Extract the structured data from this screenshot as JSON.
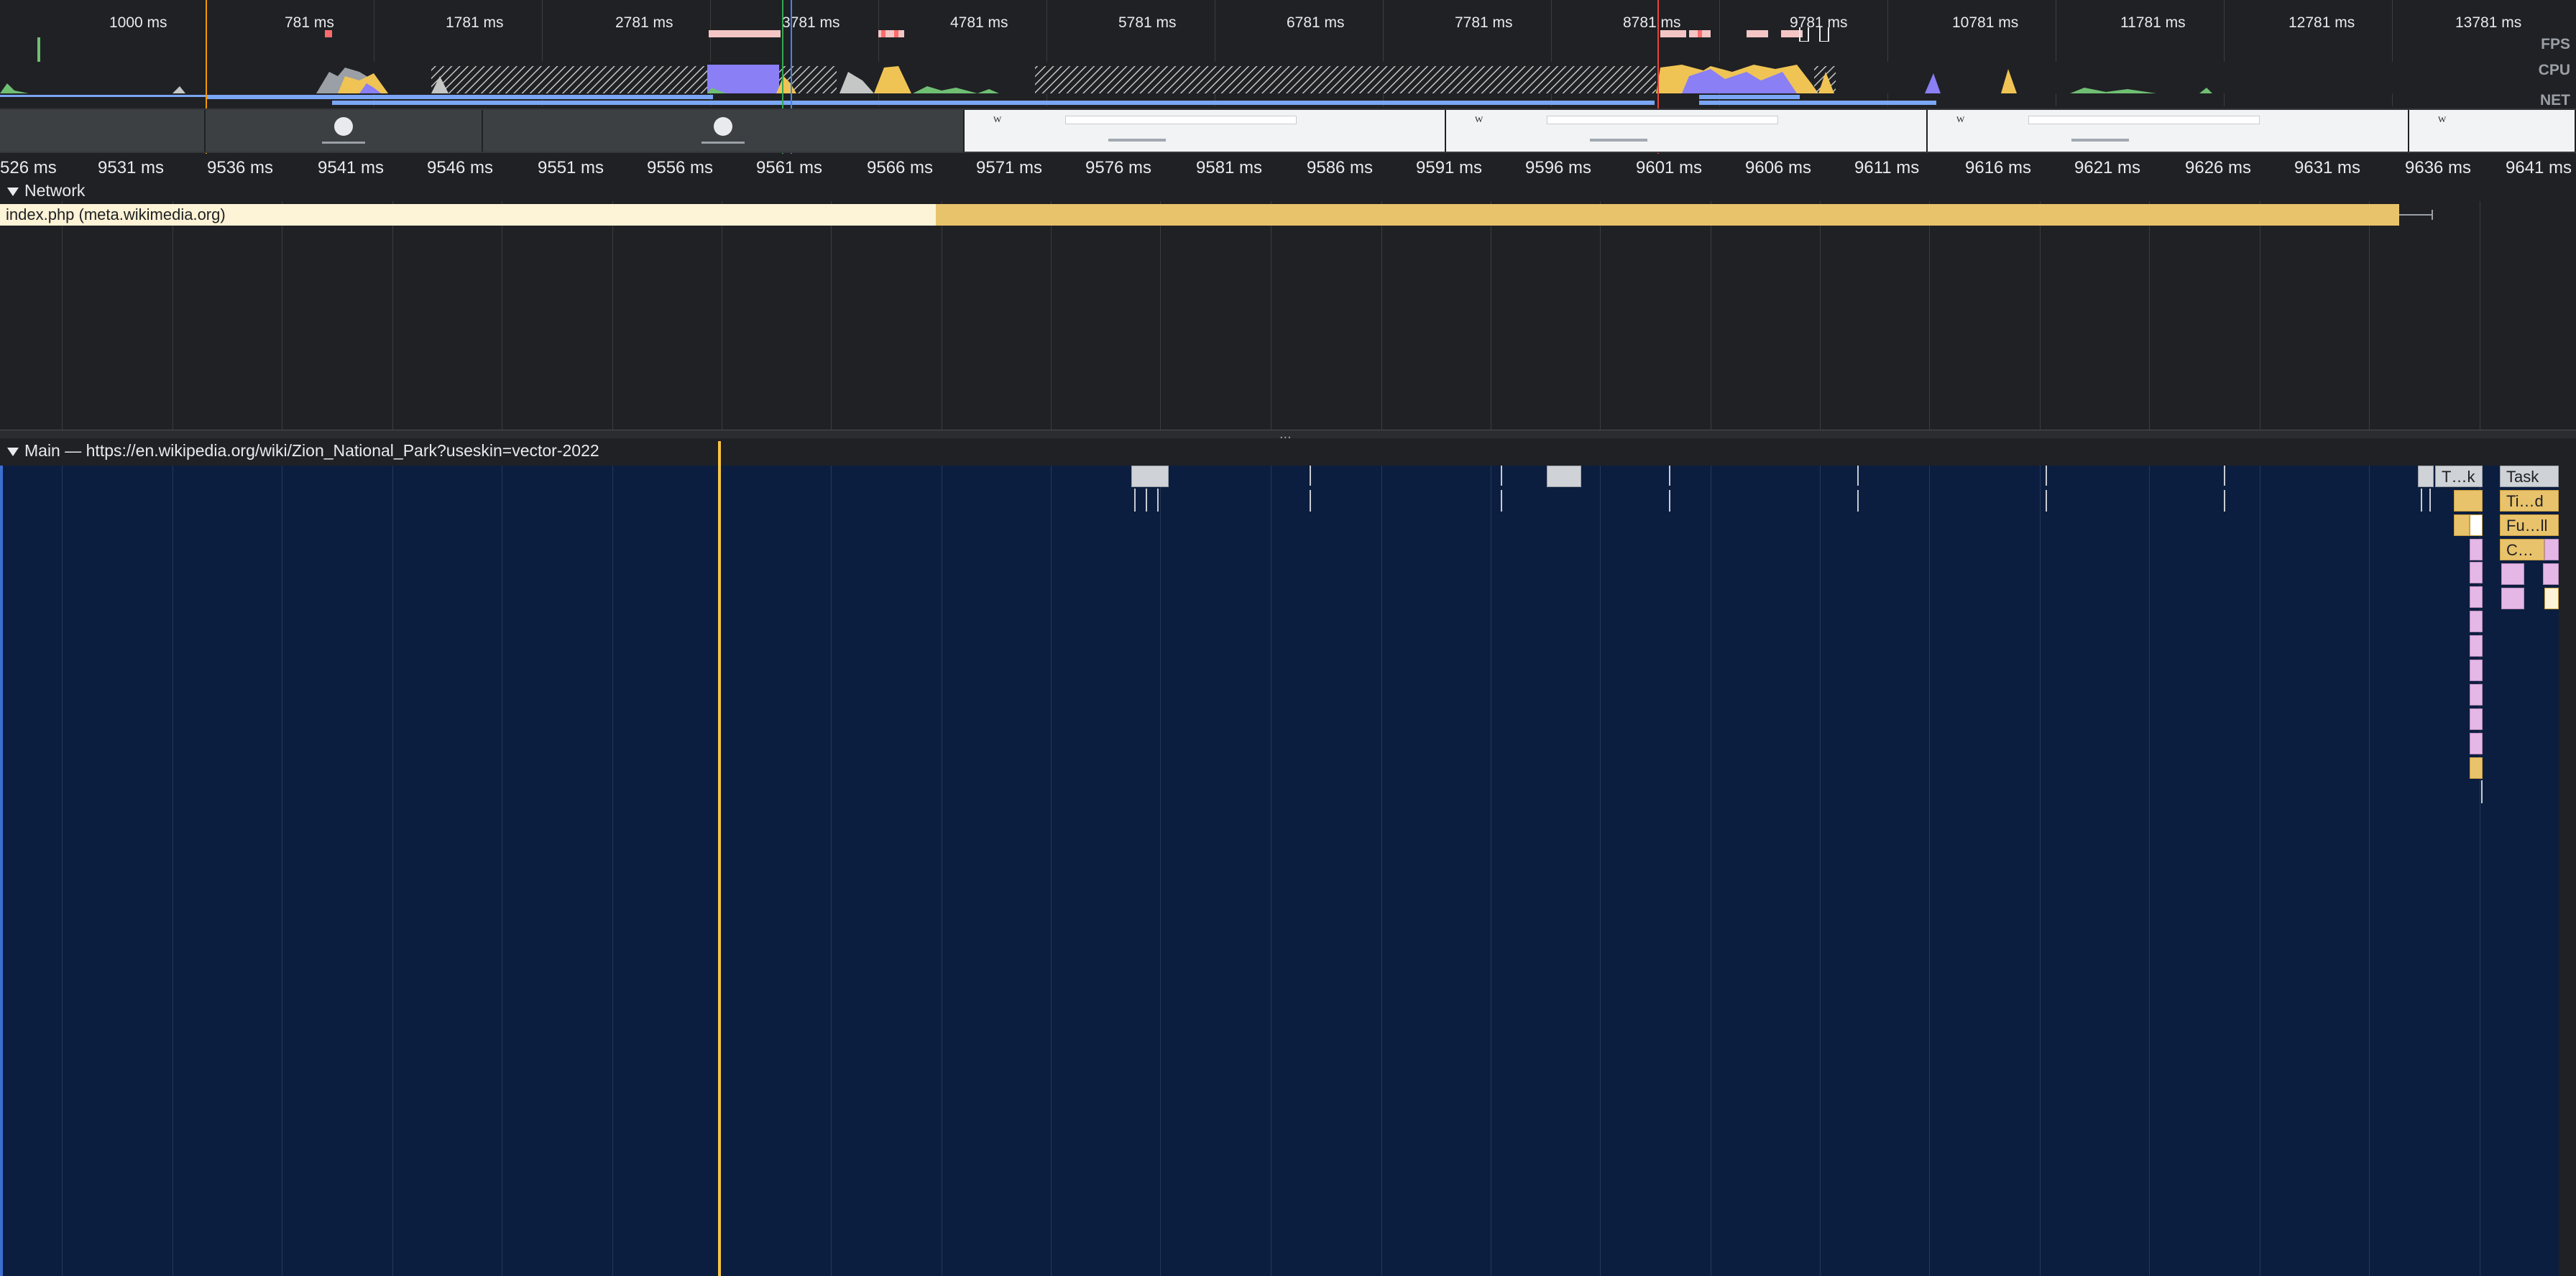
{
  "overview": {
    "tick_labels": [
      "1000 ms",
      "781 ms",
      "1781 ms",
      "2781 ms",
      "3781 ms",
      "4781 ms",
      "5781 ms",
      "6781 ms",
      "7781 ms",
      "8781 ms",
      "9781 ms",
      "10781 ms",
      "11781 ms",
      "12781 ms",
      "13781 ms"
    ],
    "tracks": {
      "fps": "FPS",
      "cpu": "CPU",
      "net": "NET"
    },
    "colors": {
      "scripting": "#f0c454",
      "rendering": "#8a7ff5",
      "painting": "#6fbf73",
      "net_bar": "#7aa6f5",
      "long_task": "#ff6b6b"
    }
  },
  "ruler": {
    "labels": [
      "526 ms",
      "9531 ms",
      "9536 ms",
      "9541 ms",
      "9546 ms",
      "9551 ms",
      "9556 ms",
      "9561 ms",
      "9566 ms",
      "9571 ms",
      "9576 ms",
      "9581 ms",
      "9586 ms",
      "9591 ms",
      "9596 ms",
      "9601 ms",
      "9606 ms",
      "9611 ms",
      "9616 ms",
      "9621 ms",
      "9626 ms",
      "9631 ms",
      "9636 ms",
      "9641 ms"
    ]
  },
  "network": {
    "title": "Network",
    "request": {
      "label": "index.php (meta.wikimedia.org)"
    }
  },
  "splitter": {
    "dots": "..."
  },
  "main": {
    "title": "Main — https://en.wikipedia.org/wiki/Zion_National_Park?useskin=vector-2022",
    "tasks": {
      "t_k": "T…k",
      "task": "Task",
      "ti_d": "Ti…d",
      "fu_ll": "Fu…ll",
      "c_dots": "C…"
    }
  }
}
